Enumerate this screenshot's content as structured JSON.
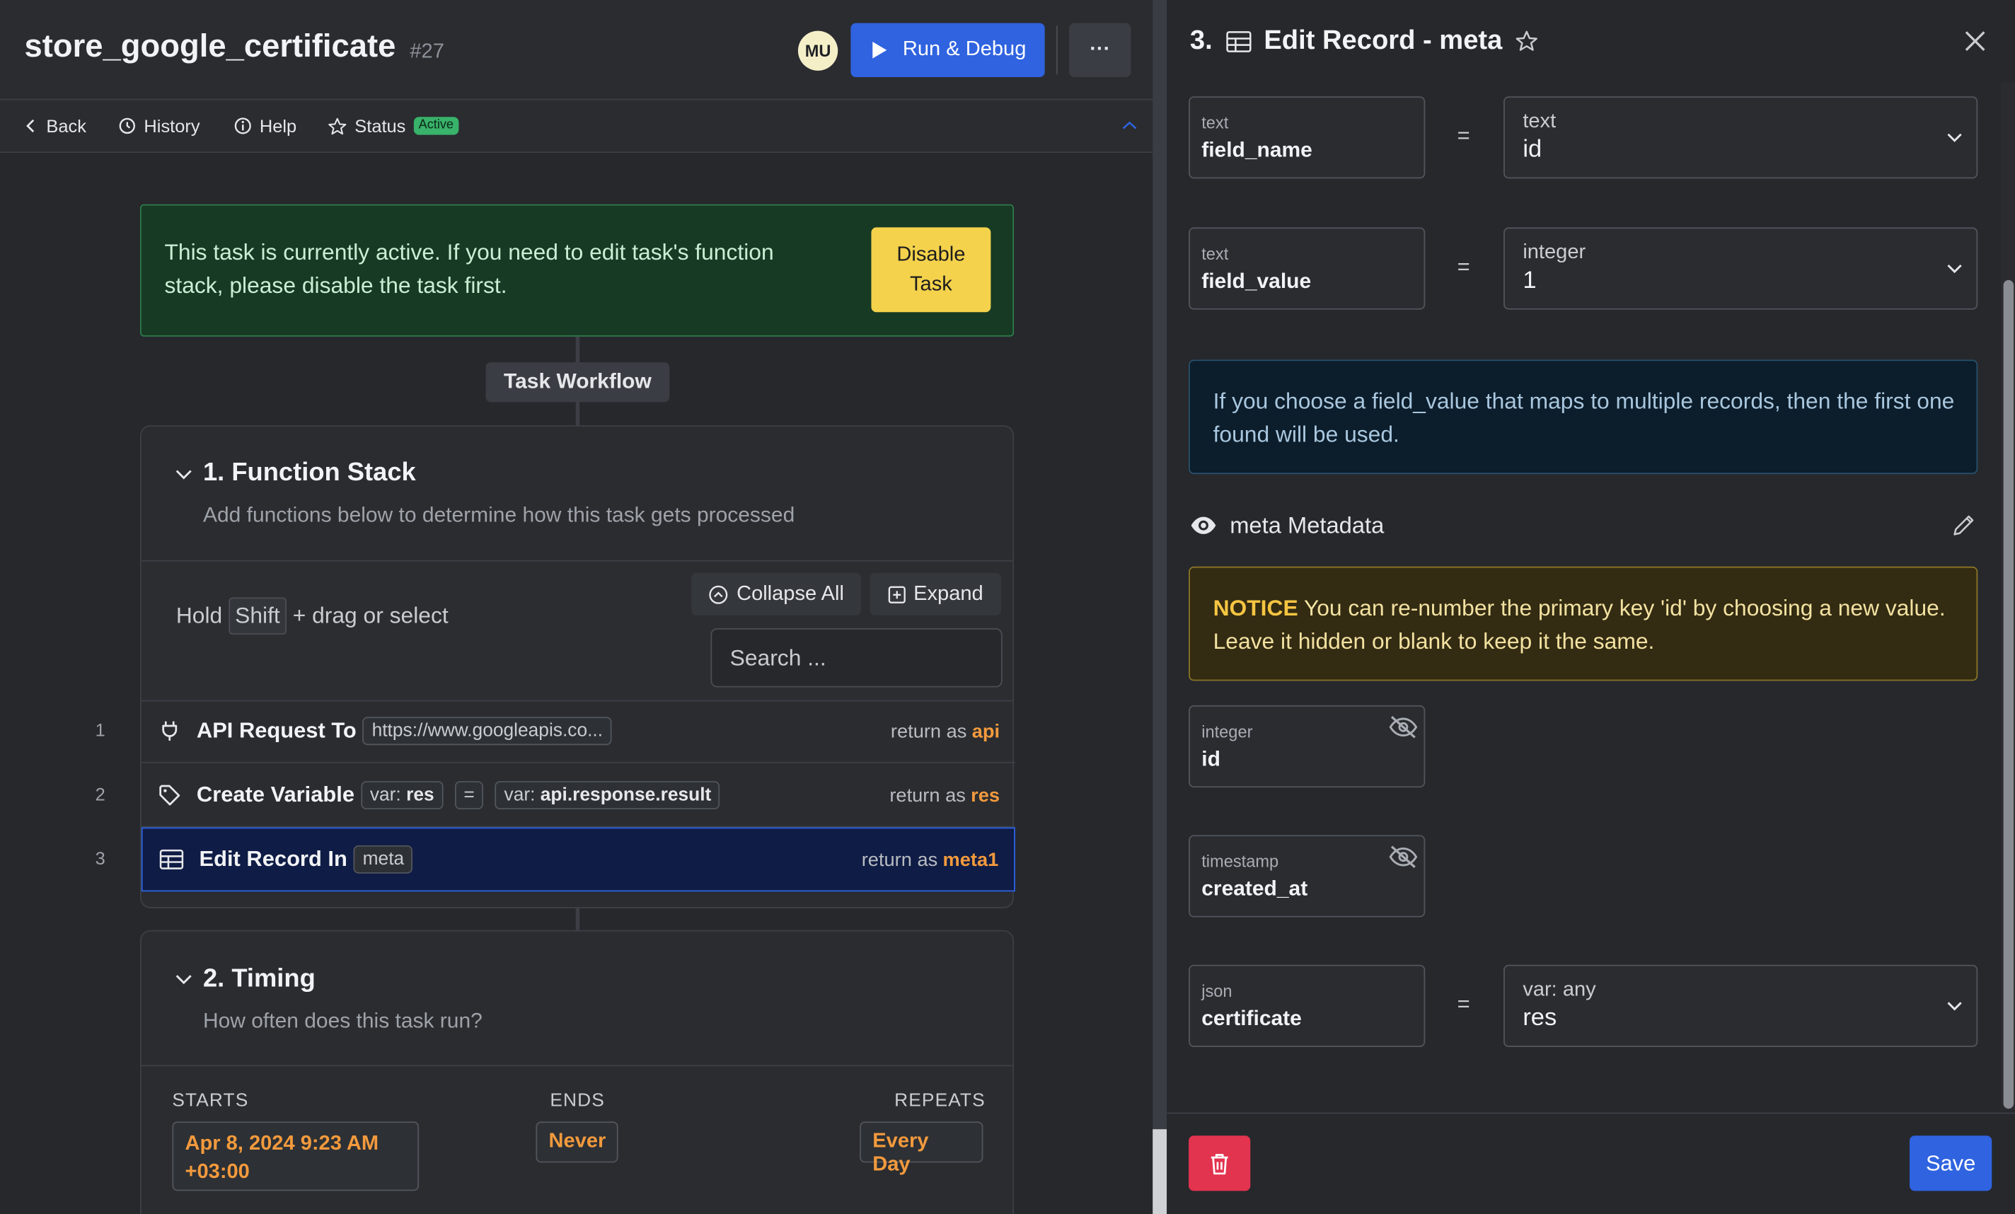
{
  "header": {
    "title": "store_google_certificate",
    "task_number": "#27",
    "avatar_initials": "MU",
    "run_debug_label": "Run & Debug",
    "more_label": "···"
  },
  "nav": {
    "back": "Back",
    "history": "History",
    "help": "Help",
    "status": "Status",
    "status_badge": "Active"
  },
  "banner": {
    "text": "This task is currently active. If you need to edit task's function stack, please disable the task first.",
    "button_line1": "Disable",
    "button_line2": "Task"
  },
  "workflow_label": "Task Workflow",
  "function_stack": {
    "title": "1. Function Stack",
    "subtitle": "Add functions below to determine how this task gets processed",
    "hint_prefix": "Hold",
    "hint_key": "Shift",
    "hint_suffix": "+ drag or select",
    "collapse_all": "Collapse All",
    "expand": "Expand",
    "search_placeholder": "Search ...",
    "steps": [
      {
        "number": "1",
        "name": "API Request To",
        "pill": "https://www.googleapis.co...",
        "return_prefix": "return as",
        "return_var": "api"
      },
      {
        "number": "2",
        "name": "Create Variable",
        "pill_a_prefix": "var:",
        "pill_a_value": "res",
        "pill_eq": "=",
        "pill_b_prefix": "var:",
        "pill_b_value": "api.response.result",
        "return_prefix": "return as",
        "return_var": "res"
      },
      {
        "number": "3",
        "name": "Edit Record In",
        "pill": "meta",
        "return_prefix": "return as",
        "return_var": "meta1"
      }
    ]
  },
  "timing": {
    "title": "2. Timing",
    "subtitle": "How often does this task run?",
    "starts_label": "STARTS",
    "ends_label": "ENDS",
    "repeats_label": "REPEATS",
    "starts_line1": "Apr 8, 2024 9:23 AM",
    "starts_line2": "+03:00",
    "ends_value": "Never",
    "repeats_value": "Every Day"
  },
  "edit_panel": {
    "title_number": "3.",
    "title": "Edit Record - meta",
    "field_name": {
      "type": "text",
      "label": "field_name",
      "equals": "=",
      "select_type": "text",
      "select_value": "id"
    },
    "field_value": {
      "type": "text",
      "label": "field_value",
      "equals": "=",
      "select_type": "integer",
      "select_value": "1"
    },
    "info_text": "If you choose a field_value that maps to multiple records, then the first one found will be used.",
    "metadata_label": "meta Metadata",
    "notice_bold": "NOTICE",
    "notice_text": " You can re-number the primary key 'id' by choosing a new value. Leave it hidden or blank to keep it the same.",
    "id_field": {
      "type": "integer",
      "label": "id"
    },
    "created_at_field": {
      "type": "timestamp",
      "label": "created_at"
    },
    "certificate_field": {
      "type": "json",
      "label": "certificate",
      "equals": "=",
      "select_type": "var: any",
      "select_value": "res"
    },
    "save_label": "Save"
  },
  "colors": {
    "accent_blue": "#2f63e0",
    "return_orange": "#f39a3d",
    "status_green": "#39b26a",
    "warning_yellow": "#f4d24c",
    "danger_red": "#e2344f"
  },
  "icons": [
    "play-icon",
    "chevron-left-icon",
    "history-icon",
    "info-icon",
    "star-icon",
    "chevron-up-icon",
    "chevron-down-icon",
    "collapse-icon",
    "expand-icon",
    "plug-icon",
    "tag-icon",
    "table-icon",
    "close-icon",
    "eye-icon",
    "eye-off-icon",
    "pencil-icon",
    "trash-icon"
  ]
}
